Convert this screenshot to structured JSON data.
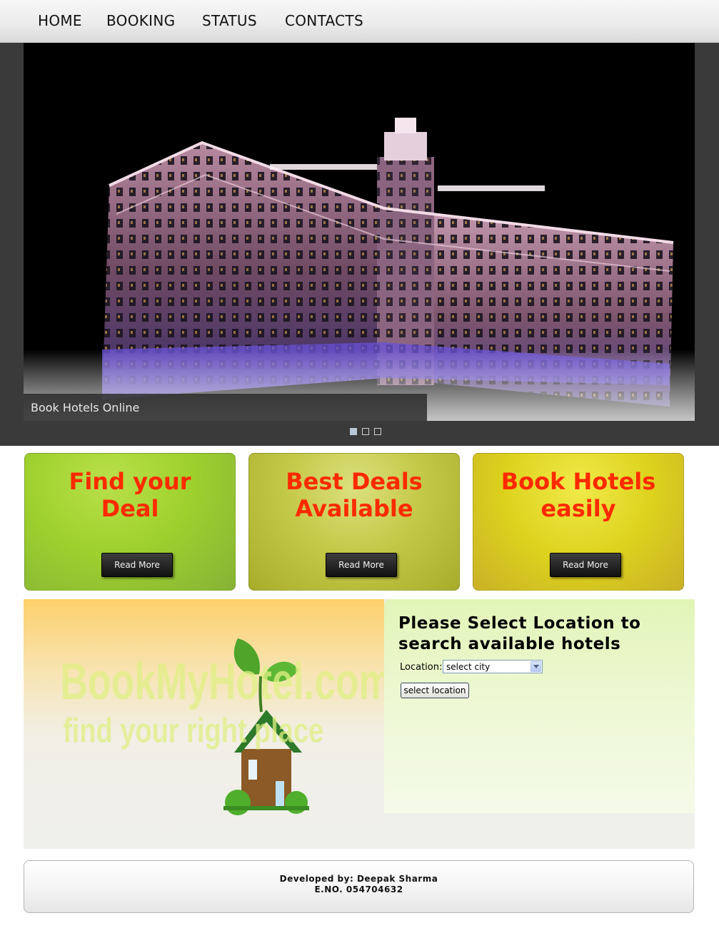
{
  "nav": {
    "items": [
      {
        "label": "HOME"
      },
      {
        "label": "BOOKING"
      },
      {
        "label": "STATUS"
      },
      {
        "label": "CONTACTS"
      }
    ]
  },
  "slider": {
    "caption": "Book Hotels Online",
    "slide_count": 3,
    "active_slide": 1
  },
  "features": [
    {
      "title_line1": "Find your",
      "title_line2": "Deal",
      "button": "Read More"
    },
    {
      "title_line1": "Best Deals",
      "title_line2": "Available",
      "button": "Read More"
    },
    {
      "title_line1": "Book Hotels",
      "title_line2": "easily",
      "button": "Read More"
    }
  ],
  "logo": {
    "brand_text": "BookMyHotel.com",
    "tagline": "find your right place"
  },
  "search": {
    "heading_line1": "Please Select Location to",
    "heading_line2": "search available hotels",
    "location_label": "Location:",
    "select_value": "select city",
    "submit_label": "select location"
  },
  "footer": {
    "line1": "Developed by: Deepak Sharma",
    "line2": "E.NO. 054704632"
  },
  "colors": {
    "feature_title": "#ff2a00",
    "slider_bg": "#3a3a3a"
  }
}
